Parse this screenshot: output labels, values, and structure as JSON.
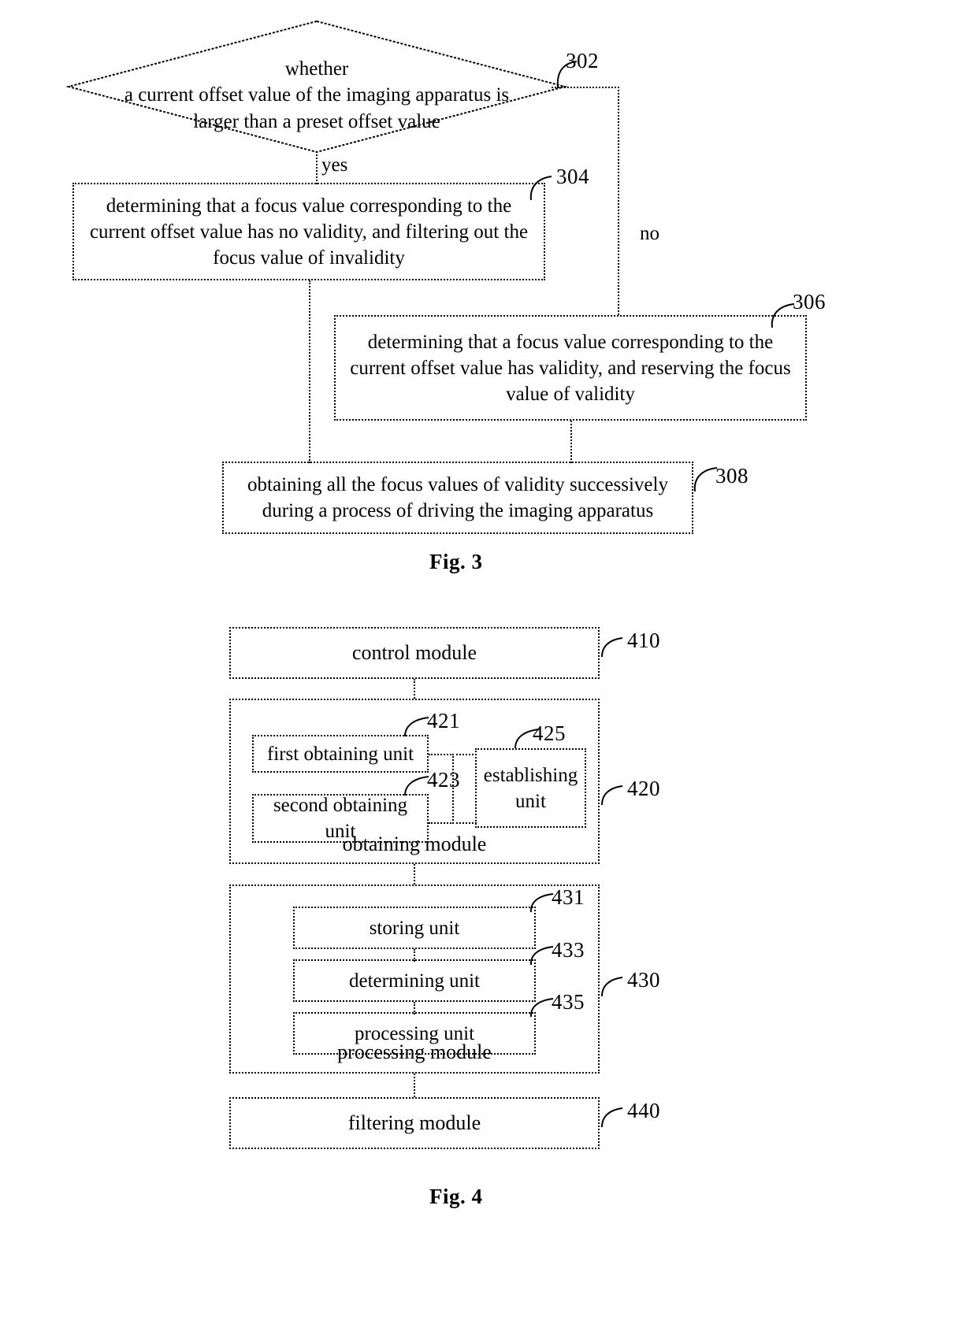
{
  "document": {
    "type": "patent-drawing-sheet",
    "figures": [
      "Fig. 3",
      "Fig. 4"
    ]
  },
  "fig3": {
    "caption": "Fig. 3",
    "decision": {
      "ref": "302",
      "line1": "whether",
      "line2": "a current offset value of the imaging apparatus is",
      "line3": "larger than a preset offset value"
    },
    "branches": {
      "yes": "yes",
      "no": "no"
    },
    "steps": [
      {
        "ref": "304",
        "line1": "determining that a focus value corresponding to the",
        "line2": "current offset value has no validity, and filtering out the",
        "line3": "focus value of invalidity"
      },
      {
        "ref": "306",
        "line1": "determining that a focus value corresponding to the",
        "line2": "current offset value has validity, and reserving the focus",
        "line3": "value of validity"
      },
      {
        "ref": "308",
        "line1": "obtaining all the focus values of validity successively",
        "line2": "during a process of driving the imaging apparatus",
        "line3": ""
      }
    ]
  },
  "fig4": {
    "caption": "Fig. 4",
    "control_module": {
      "label": "control module",
      "ref": "410"
    },
    "obtaining_module": {
      "label": "obtaining module",
      "ref": "420",
      "units": [
        {
          "label": "first obtaining unit",
          "ref": "421"
        },
        {
          "label": "second obtaining unit",
          "ref": "423"
        },
        {
          "label": "establishing unit",
          "ref": "425"
        }
      ]
    },
    "processing_module": {
      "label": "processing module",
      "ref": "430",
      "units": [
        {
          "label": "storing unit",
          "ref": "431"
        },
        {
          "label": "determining unit",
          "ref": "433"
        },
        {
          "label": "processing unit",
          "ref": "435"
        }
      ]
    },
    "filtering_module": {
      "label": "filtering module",
      "ref": "440"
    }
  },
  "colors": {
    "ink": "#000000",
    "paper": "#ffffff"
  }
}
